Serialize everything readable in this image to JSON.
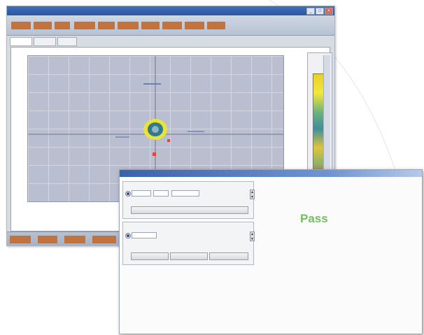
{
  "back_window": {
    "title": "",
    "menu_buttons": [
      "",
      "",
      "",
      "",
      "",
      "",
      "",
      "",
      "",
      ""
    ],
    "tabs": [
      "",
      "",
      ""
    ],
    "plot_caption": "",
    "plot_top_label": "",
    "plot_left_label": "",
    "bottom_buttons": [
      "",
      "",
      "",
      ""
    ],
    "colors": {
      "menu_button": "#c2723a",
      "plot_background": "#b9bfd0",
      "ring_outer": "#e8e23a",
      "ring_inner": "#2f7a8c",
      "marker": "#d94a3a"
    }
  },
  "front_window": {
    "title": "",
    "group1": {
      "label": "",
      "field_a": "",
      "field_b": "",
      "field_c": "",
      "value_right": "",
      "wide_button": ""
    },
    "group2": {
      "label": "",
      "field_a": "",
      "value_right": "",
      "caption_left": "",
      "caption_right": "",
      "buttons": [
        "",
        "",
        ""
      ]
    },
    "result": {
      "title": "",
      "subtitle": "",
      "status": "Pass",
      "stat_line_1": "",
      "stat_line_2": "",
      "status_color": "#6fc25c"
    },
    "table": {
      "headers": [
        "",
        "",
        "",
        "",
        "",
        "",
        ""
      ],
      "rows": [
        {
          "label": "",
          "values": [
            "",
            "",
            "",
            "",
            "",
            ""
          ]
        },
        {
          "label": "",
          "values": [
            "",
            "",
            "",
            "",
            "",
            ""
          ]
        },
        {
          "label": "",
          "values": [
            "",
            "",
            "",
            "",
            "",
            ""
          ]
        },
        {
          "label": "",
          "values": [
            "",
            "",
            "",
            "",
            "",
            ""
          ]
        }
      ]
    }
  }
}
